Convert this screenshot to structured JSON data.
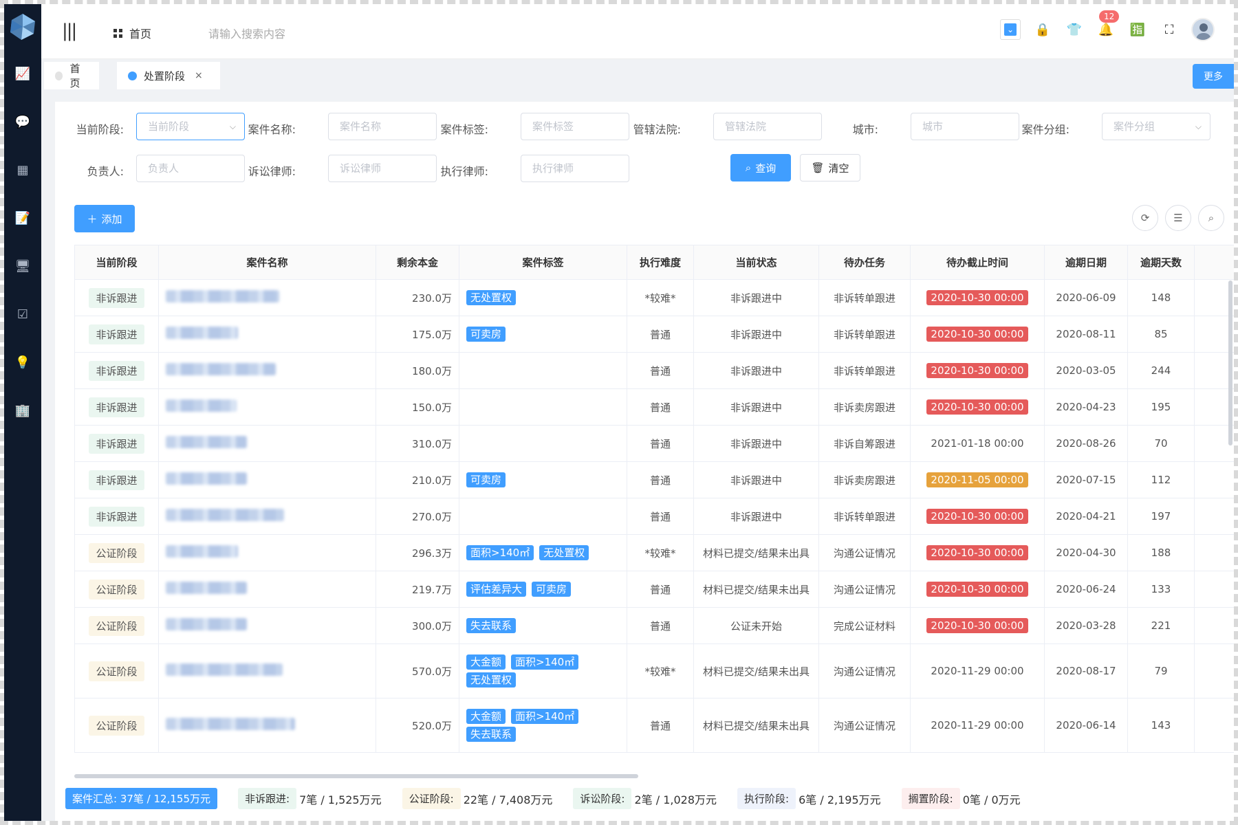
{
  "header": {
    "home_label": "首页",
    "search_placeholder": "请输入搜索内容",
    "notification_count": "12"
  },
  "tabs": [
    {
      "label": "首页"
    },
    {
      "label": "处置阶段",
      "close": "×"
    }
  ],
  "more_label": "更多",
  "filters": {
    "stage": {
      "label": "当前阶段:",
      "placeholder": "当前阶段"
    },
    "case_name": {
      "label": "案件名称:",
      "placeholder": "案件名称"
    },
    "case_tag": {
      "label": "案件标签:",
      "placeholder": "案件标签"
    },
    "court": {
      "label": "管辖法院:",
      "placeholder": "管辖法院"
    },
    "city": {
      "label": "城市:",
      "placeholder": "城市"
    },
    "case_group": {
      "label": "案件分组:",
      "placeholder": "案件分组"
    },
    "owner": {
      "label": "负责人:",
      "placeholder": "负责人"
    },
    "lit_lawyer": {
      "label": "诉讼律师:",
      "placeholder": "诉讼律师"
    },
    "exec_lawyer": {
      "label": "执行律师:",
      "placeholder": "执行律师"
    }
  },
  "buttons": {
    "query": "查询",
    "clear": "清空",
    "add": "添加"
  },
  "table": {
    "columns": [
      "当前阶段",
      "案件名称",
      "剩余本金",
      "案件标签",
      "执行难度",
      "当前状态",
      "待办任务",
      "待办截止时间",
      "逾期日期",
      "逾期天数"
    ],
    "rows": [
      {
        "stage": "非诉跟进",
        "stage_type": "ns",
        "principal": "230.0万",
        "tags": [
          "无处置权"
        ],
        "difficulty": "*较难*",
        "status": "非诉跟进中",
        "task": "非诉转单跟进",
        "due": "2020-10-30 00:00",
        "due_style": "red",
        "overdue_date": "2020-06-09",
        "overdue_days": "148"
      },
      {
        "stage": "非诉跟进",
        "stage_type": "ns",
        "principal": "175.0万",
        "tags": [
          "可卖房"
        ],
        "difficulty": "普通",
        "status": "非诉跟进中",
        "task": "非诉转单跟进",
        "due": "2020-10-30 00:00",
        "due_style": "red",
        "overdue_date": "2020-08-11",
        "overdue_days": "85"
      },
      {
        "stage": "非诉跟进",
        "stage_type": "ns",
        "principal": "180.0万",
        "tags": [],
        "difficulty": "普通",
        "status": "非诉跟进中",
        "task": "非诉转单跟进",
        "due": "2020-10-30 00:00",
        "due_style": "red",
        "overdue_date": "2020-03-05",
        "overdue_days": "244"
      },
      {
        "stage": "非诉跟进",
        "stage_type": "ns",
        "principal": "150.0万",
        "tags": [],
        "difficulty": "普通",
        "status": "非诉跟进中",
        "task": "非诉卖房跟进",
        "due": "2020-10-30 00:00",
        "due_style": "red",
        "overdue_date": "2020-04-23",
        "overdue_days": "195"
      },
      {
        "stage": "非诉跟进",
        "stage_type": "ns",
        "principal": "310.0万",
        "tags": [],
        "difficulty": "普通",
        "status": "非诉跟进中",
        "task": "非诉自筹跟进",
        "due": "2021-01-18 00:00",
        "due_style": "plain",
        "overdue_date": "2020-08-26",
        "overdue_days": "70"
      },
      {
        "stage": "非诉跟进",
        "stage_type": "ns",
        "principal": "210.0万",
        "tags": [
          "可卖房"
        ],
        "difficulty": "普通",
        "status": "非诉跟进中",
        "task": "非诉卖房跟进",
        "due": "2020-11-05 00:00",
        "due_style": "orange",
        "overdue_date": "2020-07-15",
        "overdue_days": "112"
      },
      {
        "stage": "非诉跟进",
        "stage_type": "ns",
        "principal": "270.0万",
        "tags": [],
        "difficulty": "普通",
        "status": "非诉跟进中",
        "task": "非诉转单跟进",
        "due": "2020-10-30 00:00",
        "due_style": "red",
        "overdue_date": "2020-04-21",
        "overdue_days": "197"
      },
      {
        "stage": "公证阶段",
        "stage_type": "gz",
        "principal": "296.3万",
        "tags": [
          "面积>140㎡",
          "无处置权"
        ],
        "difficulty": "*较难*",
        "status": "材料已提交/结果未出具",
        "task": "沟通公证情况",
        "due": "2020-10-30 00:00",
        "due_style": "red",
        "overdue_date": "2020-04-30",
        "overdue_days": "188"
      },
      {
        "stage": "公证阶段",
        "stage_type": "gz",
        "principal": "219.7万",
        "tags": [
          "评估差异大",
          "可卖房"
        ],
        "difficulty": "普通",
        "status": "材料已提交/结果未出具",
        "task": "沟通公证情况",
        "due": "2020-10-30 00:00",
        "due_style": "red",
        "overdue_date": "2020-06-24",
        "overdue_days": "133"
      },
      {
        "stage": "公证阶段",
        "stage_type": "gz",
        "principal": "300.0万",
        "tags": [
          "失去联系"
        ],
        "difficulty": "普通",
        "status": "公证未开始",
        "task": "完成公证材料",
        "due": "2020-10-30 00:00",
        "due_style": "red",
        "overdue_date": "2020-03-28",
        "overdue_days": "221"
      },
      {
        "stage": "公证阶段",
        "stage_type": "gz",
        "principal": "570.0万",
        "tags": [
          "大金额",
          "面积>140㎡",
          "无处置权"
        ],
        "difficulty": "*较难*",
        "status": "材料已提交/结果未出具",
        "task": "沟通公证情况",
        "due": "2020-11-29 00:00",
        "due_style": "plain",
        "overdue_date": "2020-08-17",
        "overdue_days": "79"
      },
      {
        "stage": "公证阶段",
        "stage_type": "gz",
        "principal": "520.0万",
        "tags": [
          "大金额",
          "面积>140㎡",
          "失去联系"
        ],
        "difficulty": "普通",
        "status": "材料已提交/结果未出具",
        "task": "沟通公证情况",
        "due": "2020-11-29 00:00",
        "due_style": "plain",
        "overdue_date": "2020-06-14",
        "overdue_days": "143"
      }
    ]
  },
  "summary": {
    "total": "案件汇总:  37笔 / 12,155万元",
    "items": [
      {
        "label": "非诉跟进:",
        "value": "7笔 / 1,525万元",
        "bg": "#eaf6f0"
      },
      {
        "label": "公证阶段:",
        "value": "22笔 / 7,408万元",
        "bg": "#fbf5e6"
      },
      {
        "label": "诉讼阶段:",
        "value": "2笔 / 1,028万元",
        "bg": "#eaf6f0"
      },
      {
        "label": "执行阶段:",
        "value": "6笔 / 2,195万元",
        "bg": "#eef2fb"
      },
      {
        "label": "搁置阶段:",
        "value": "0笔 / 0万元",
        "bg": "#fdeeee"
      }
    ]
  },
  "colors": {
    "accent": "#409eff",
    "sidebar": "#0f1a2c",
    "due_red": "#e55a5a",
    "due_orange": "#e6a23c"
  }
}
